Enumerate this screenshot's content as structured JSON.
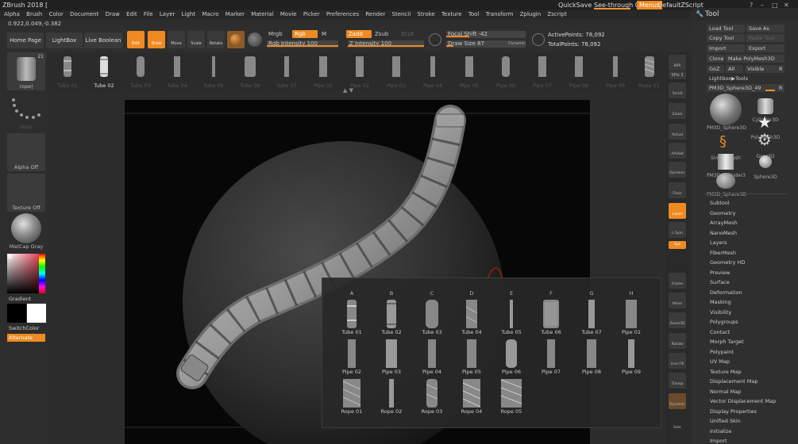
{
  "app": {
    "title": "ZBrush 2018 [",
    "quicksave": "QuickSave",
    "see_through": "See-through   0",
    "menus": "Menus",
    "default_script": "DefaultZScript",
    "window_controls": [
      "?",
      "–",
      "□",
      "✕"
    ]
  },
  "menubar": [
    "Alpha",
    "Brush",
    "Color",
    "Document",
    "Draw",
    "Edit",
    "File",
    "Layer",
    "Light",
    "Macro",
    "Marker",
    "Material",
    "Movie",
    "Picker",
    "Preferences",
    "Render",
    "Stencil",
    "Stroke",
    "Texture",
    "Tool",
    "Transform",
    "Zplugin",
    "Zscript"
  ],
  "coords": "0.922,0.049,-0.382",
  "toolbar": {
    "home_page": "Home Page",
    "lightbox": "LightBox",
    "live_boolean": "Live Boolean",
    "edit": "Edit",
    "draw": "Draw",
    "move": "Move",
    "scale": "Scale",
    "rotate": "Rotate",
    "mrgb": "Mrgb",
    "rgb": "Rgb",
    "m": "M",
    "zadd": "Zadd",
    "zsub": "Zsub",
    "zcut": "Zcut",
    "rgb_intensity": "Rgb Intensity 100",
    "z_intensity": "Z Intensity 100",
    "focal_shift": "Focal Shift -42",
    "draw_size": "Draw Size 87",
    "dynamic": "Dynamic",
    "active_points": "ActivePoints: 78,092",
    "total_points": "TotalPoints: 78,092"
  },
  "left_shelf": {
    "brush_label": "rope|",
    "brush_count": "21",
    "stroke_label": "Dots",
    "alpha_label": "Alpha Off",
    "texture_label": "Texture Off",
    "material_label": "MatCap Gray",
    "gradient_label": "Gradient",
    "switch_color": "SwitchColor",
    "alternate": "Alternate"
  },
  "strip_items": [
    "Tube 01",
    "Tube 02",
    "Tube 03",
    "Tube 04",
    "Tube 05",
    "Tube 06",
    "Tube 07",
    "Pipe 01",
    "Pipe 02",
    "Pipe 03",
    "Pipe 04",
    "Pipe 05",
    "Pipe 06",
    "Pipe 07",
    "Pipe 08",
    "Pipe 09",
    "Rope 01"
  ],
  "right_dock": [
    "BPR",
    "Scroll",
    "Zoom",
    "Actual",
    "AAHalf",
    "Dynamic Persp",
    "Floor",
    "Local",
    "L.Sym",
    "Xyz",
    "Frame",
    "Move",
    "Zoom3D",
    "Rotate",
    "Line Fill PolyF",
    "Transp",
    "Dynamic Solo"
  ],
  "tool_panel": {
    "title": "Tool",
    "load_tool": "Load Tool",
    "save_as": "Save As",
    "copy_tool": "Copy Tool",
    "paste_tool": "Paste Tool",
    "import": "Import",
    "export": "Export",
    "clone": "Clone",
    "make_polymesh": "Make PolyMesh3D",
    "goz": "GoZ",
    "all": "All",
    "visible": "Visible",
    "r": "R",
    "lightbox_tools": "Lightbox▶Tools",
    "current_tool": "PM3D_Sphere3D_49",
    "tools": [
      "PM3D_Sphere3D",
      "Cylinder3D",
      "SimpleBrush",
      "PolyMesh3D",
      "PM3D_Cylinder3",
      "Gear3D",
      "PM3D_Sphere3D",
      "Sphere3D"
    ],
    "subpalettes": [
      "Subtool",
      "Geometry",
      "ArrayMesh",
      "NanoMesh",
      "Layers",
      "FiberMesh",
      "Geometry HD",
      "Preview",
      "Surface",
      "Deformation",
      "Masking",
      "Visibility",
      "Polygroups",
      "Contact",
      "Morph Target",
      "Polypaint",
      "UV Map",
      "Texture Map",
      "Displacement Map",
      "Normal Map",
      "Vector Displacement Map",
      "Display Properties",
      "Unified Skin",
      "Initialize",
      "Import"
    ]
  },
  "popup": {
    "columns": [
      "A",
      "B",
      "C",
      "D",
      "E",
      "F",
      "G",
      "H"
    ],
    "items": [
      "Tube 01",
      "Tube 02",
      "Tube 03",
      "Tube 04",
      "Tube 05",
      "Tube 06",
      "Tube 07",
      "Pipe 01",
      "Pipe 02",
      "Pipe 03",
      "Pipe 04",
      "Pipe 05",
      "Pipe 06",
      "Pipe 07",
      "Pipe 08",
      "Pipe 09",
      "Rope 01",
      "Rope 02",
      "Rope 03",
      "Rope 04",
      "Rope 05"
    ]
  },
  "colors": {
    "accent": "#ee8a22",
    "background": "#2d2d2d",
    "viewport": "#070707"
  }
}
